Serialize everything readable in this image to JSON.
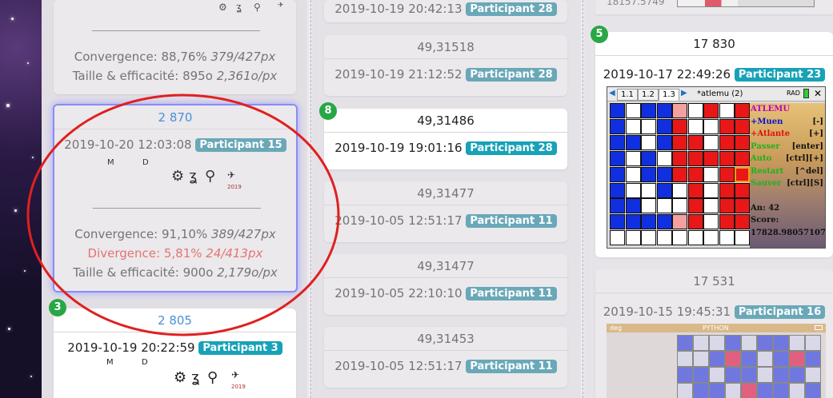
{
  "col1": {
    "top_card": {
      "convergence_label": "Convergence:",
      "convergence_value": "88,76%",
      "convergence_px": "379/427px",
      "taille_label": "Taille & efficacité:",
      "taille_value": "895o",
      "taille_ratio": "2,361o/px"
    },
    "selected_card": {
      "score": "2 870",
      "datetime": "2019-10-20 12:03:08",
      "participant": "Participant 15",
      "icon_m": "M",
      "icon_d": "D",
      "convergence_label": "Convergence:",
      "convergence_value": "91,10%",
      "convergence_px": "389/427px",
      "divergence_label": "Divergence:",
      "divergence_value": "5,81%",
      "divergence_px": "24/413px",
      "taille_label": "Taille & efficacité:",
      "taille_value": "900o",
      "taille_ratio": "2,179o/px",
      "year": "2019"
    },
    "card3": {
      "rank": "3",
      "score": "2 805",
      "datetime": "2019-10-19 20:22:59",
      "participant": "Participant 3",
      "icon_m": "M",
      "icon_d": "D",
      "year": "2019"
    }
  },
  "col2": {
    "cards": [
      {
        "value": "",
        "datetime": "2019-10-19 20:42:13",
        "participant": "Participant 28"
      },
      {
        "value": "49,31518",
        "datetime": "2019-10-19 21:12:52",
        "participant": "Participant 28"
      },
      {
        "rank": "8",
        "value": "49,31486",
        "datetime": "2019-10-19 19:01:16",
        "participant": "Participant 28"
      },
      {
        "value": "49,31477",
        "datetime": "2019-10-05 12:51:17",
        "participant": "Participant 11"
      },
      {
        "value": "49,31477",
        "datetime": "2019-10-05 22:10:10",
        "participant": "Participant 11"
      },
      {
        "value": "49,31453",
        "datetime": "2019-10-05 12:51:17",
        "participant": "Participant 11"
      }
    ]
  },
  "col3": {
    "top_value": "18157.5749",
    "card5": {
      "rank": "5",
      "score": "17 830",
      "datetime": "2019-10-17 22:49:26",
      "participant": "Participant 23"
    },
    "calc": {
      "tabs": [
        "1.1",
        "1.2",
        "1.3"
      ],
      "doc_title": "*atlemu (2)",
      "mode": "RAD",
      "side_title": "ATLEMU",
      "side_rows": [
        {
          "label": "+Muen",
          "key": "[-]",
          "color": "#1010d0"
        },
        {
          "label": "+Atlante",
          "key": "[+]",
          "color": "#e01010"
        },
        {
          "label": "Passer",
          "key": "[enter]",
          "color": "#20b020"
        },
        {
          "label": "Auto",
          "key": "[ctrl][+]",
          "color": "#20b020"
        },
        {
          "label": "Restart",
          "key": "[^del]",
          "color": "#20b020"
        },
        {
          "label": "Sauver",
          "key": "[ctrl][S]",
          "color": "#20b020"
        }
      ],
      "an_label": "An: 42",
      "score_label": "Score:",
      "score_value": "17828.98057107"
    },
    "card_next": {
      "score": "17 531",
      "datetime": "2019-10-15 19:45:31",
      "participant": "Participant 16",
      "mode": "deg",
      "app": "PYTHON"
    }
  }
}
